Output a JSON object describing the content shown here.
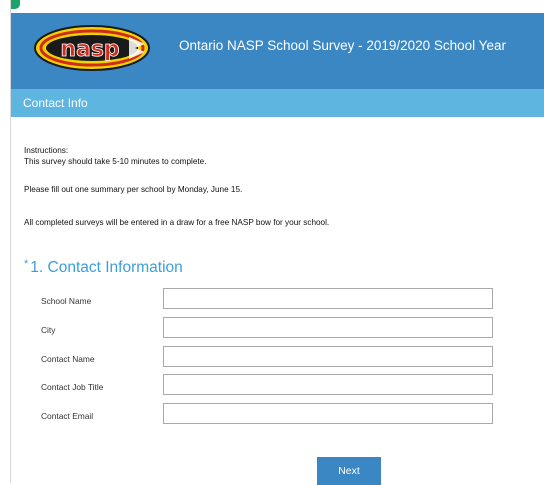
{
  "header": {
    "logo_text": "nasp",
    "title": "Ontario NASP School Survey - 2019/2020 School Year"
  },
  "subbar": {
    "label": "Contact Info"
  },
  "instructions": {
    "heading": "Instructions:",
    "line1": "This survey should take 5-10 minutes to complete.",
    "line2": "Please fill out one summary per school by Monday, June 15.",
    "line3": "All completed surveys will be entered in a draw for a free NASP bow for your school."
  },
  "question": {
    "required_mark": "*",
    "title": "1. Contact Information",
    "fields": [
      {
        "label": "School Name",
        "value": ""
      },
      {
        "label": "City",
        "value": ""
      },
      {
        "label": "Contact Name",
        "value": ""
      },
      {
        "label": "Contact Job Title",
        "value": ""
      },
      {
        "label": "Contact Email",
        "value": ""
      }
    ]
  },
  "next_label": "Next",
  "colors": {
    "header_bg": "#3a87c4",
    "subbar_bg": "#5eb5e0",
    "question_title": "#3a9fd8",
    "button_bg": "#3a87c4",
    "logo_yellow": "#f2d300",
    "logo_red": "#d12b1e"
  }
}
